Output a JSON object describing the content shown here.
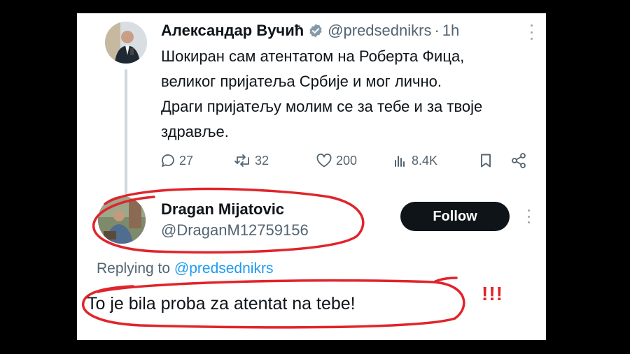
{
  "tweet": {
    "author_name": "Александар Вучић",
    "handle": "@predsednikrs",
    "separator": "·",
    "time": "1h",
    "body_lines": [
      "Шокиран сам атентатом на Роберта Фица,",
      "великог пријатеља Србије и мог лично.",
      "Драги пријатељу молим се за тебе и за твоје",
      "здравље."
    ],
    "actions": {
      "replies": "27",
      "reposts": "32",
      "likes": "200",
      "views": "8.4K"
    }
  },
  "reply": {
    "author_name": "Dragan Mijatovic",
    "handle": "@DraganM12759156",
    "follow_label": "Follow",
    "replying_prefix": "Replying to",
    "replying_handle": "@predsednikrs",
    "text": "To je bila proba za atentat na tebe!"
  },
  "annotation": {
    "exclamation": "!!!",
    "color": "#e0242b"
  },
  "colors": {
    "verified": "#829aab",
    "link": "#1d9bf0",
    "follow_bg": "#0f1419"
  },
  "icons": [
    "verified-badge-icon",
    "more-icon",
    "reply-icon",
    "repost-icon",
    "like-icon",
    "views-icon",
    "bookmark-icon",
    "share-icon"
  ]
}
